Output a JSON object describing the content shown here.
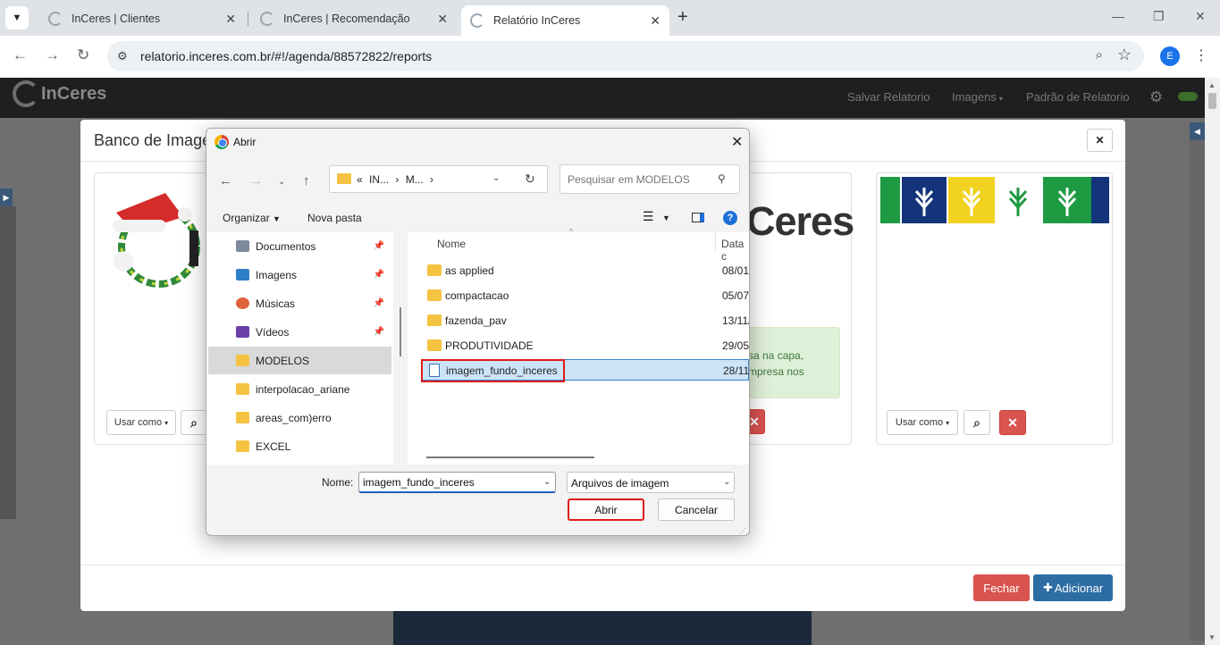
{
  "browser": {
    "tabs": [
      {
        "title": "InCeres | Clientes"
      },
      {
        "title": "InCeres | Recomendação"
      },
      {
        "title": "Relatório InCeres"
      }
    ],
    "url": "relatorio.inceres.com.br/#!/agenda/88572822/reports",
    "profile_initial": "E"
  },
  "app": {
    "brand": "InCeres",
    "nav": {
      "save": "Salvar Relatorio",
      "images": "Imagens",
      "pattern": "Padrão de Relatorio"
    }
  },
  "modal": {
    "title": "Banco de Imagens",
    "logo_text": "Ceres",
    "alert_text": "sa na capa, mpresa nos",
    "use_as_label": "Usar como",
    "close_label": "Fechar",
    "add_label": "Adicionar"
  },
  "dialog": {
    "title": "Abrir",
    "breadcrumb": [
      "IN...",
      "M..."
    ],
    "breadcrumb_prefix": "«",
    "search_placeholder": "Pesquisar em MODELOS",
    "organize_label": "Organizar",
    "new_folder_label": "Nova pasta",
    "columns": {
      "name": "Nome",
      "date": "Data c"
    },
    "nav_items": [
      {
        "label": "Documentos",
        "icon": "documents-icon",
        "pinned": true
      },
      {
        "label": "Imagens",
        "icon": "pictures-icon",
        "pinned": true
      },
      {
        "label": "Músicas",
        "icon": "music-icon",
        "pinned": true
      },
      {
        "label": "Vídeos",
        "icon": "videos-icon",
        "pinned": true
      },
      {
        "label": "MODELOS",
        "icon": "folder-icon",
        "pinned": false
      },
      {
        "label": "interpolacao_ariane",
        "icon": "folder-icon",
        "pinned": false
      },
      {
        "label": "areas_com)erro",
        "icon": "folder-icon",
        "pinned": false
      },
      {
        "label": "EXCEL",
        "icon": "folder-icon",
        "pinned": false
      }
    ],
    "files": [
      {
        "name": "as applied",
        "date": "08/01/"
      },
      {
        "name": "compactacao",
        "date": "05/07/"
      },
      {
        "name": "fazenda_pav",
        "date": "13/11/"
      },
      {
        "name": "PRODUTIVIDADE",
        "date": "29/05/"
      },
      {
        "name": "imagem_fundo_inceres",
        "date": "28/11/"
      }
    ],
    "filename_label": "Nome:",
    "filename_value": "imagem_fundo_inceres",
    "filetype_value": "Arquivos de imagem",
    "open_label": "Abrir",
    "cancel_label": "Cancelar"
  }
}
